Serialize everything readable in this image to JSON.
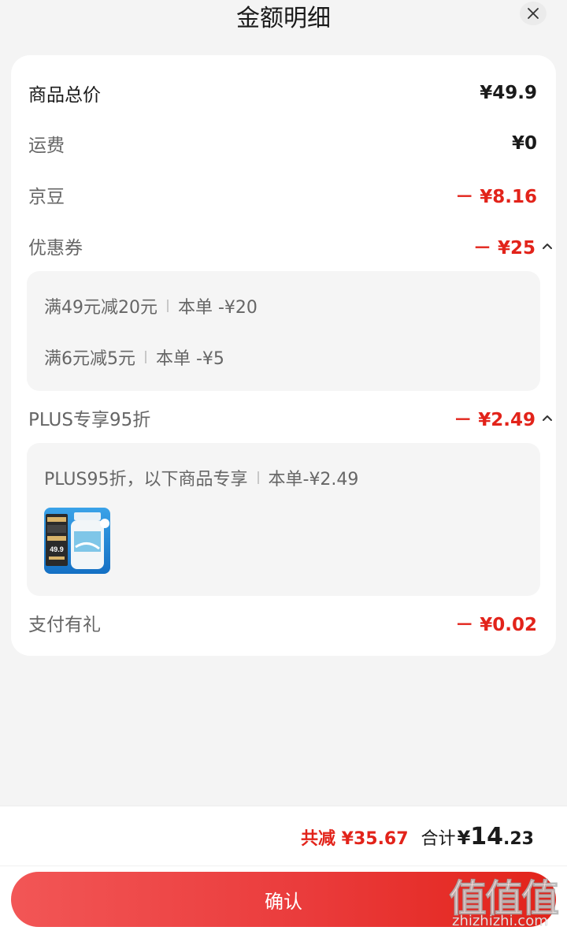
{
  "header": {
    "title": "金额明细",
    "close_icon": "close-icon"
  },
  "rows": {
    "goods_total": {
      "label": "商品总价",
      "value": "¥49.9"
    },
    "shipping": {
      "label": "运费",
      "value": "¥0"
    },
    "jingdou": {
      "label": "京豆",
      "value": "－ ¥8.16"
    },
    "coupon": {
      "label": "优惠券",
      "value": "－ ¥25"
    },
    "plus": {
      "label": "PLUS专享95折",
      "value": "－ ¥2.49"
    },
    "pay_gift": {
      "label": "支付有礼",
      "value": "－ ¥0.02"
    }
  },
  "coupon_details": [
    {
      "condition": "满49元减20元",
      "order": "本单 -¥20"
    },
    {
      "condition": "满6元减5元",
      "order": "本单 -¥5"
    }
  ],
  "plus_detail": {
    "condition": "PLUS95折，以下商品专享",
    "order": "本单-¥2.49",
    "product_image": "product-thumbnail",
    "product_text": "49.9"
  },
  "footer": {
    "reduce": "共减 ¥35.67",
    "total_label": "合计",
    "total_yen": "¥",
    "total_int": "14",
    "total_dec": ".23",
    "confirm_label": "确认"
  },
  "watermark": {
    "main": "值值值",
    "sub": "zhizhizhi.com"
  },
  "colors": {
    "accent_red": "#e2231a",
    "card_bg": "#ffffff",
    "page_bg": "#f4f4f4",
    "subbox_bg": "#f5f5f5"
  }
}
